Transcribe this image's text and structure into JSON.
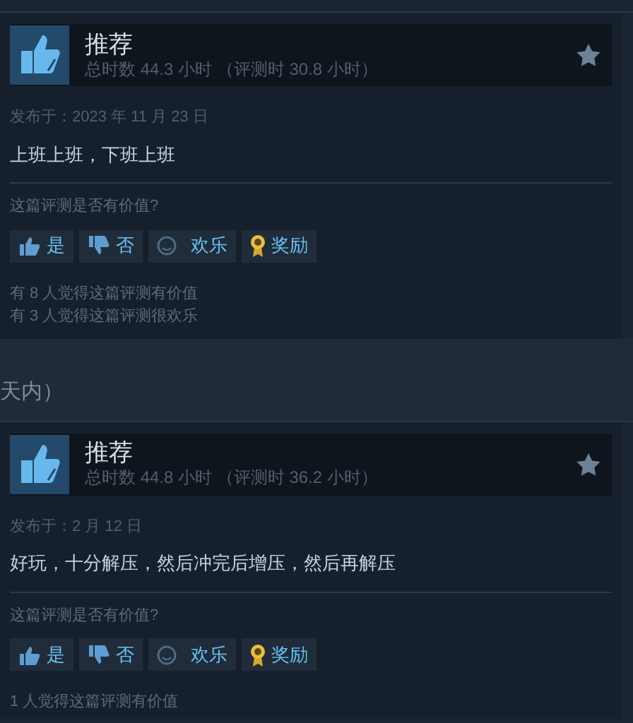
{
  "reviews": [
    {
      "verdict": "推荐",
      "hours": "总时数 44.3 小时 （评测时 30.8 小时）",
      "posted": "发布于：2023 年 11 月 23 日",
      "text": "上班上班，下班上班",
      "question": "这篇评测是否有价值?",
      "buttons": [
        {
          "kind": "yes",
          "label": "是"
        },
        {
          "kind": "no",
          "label": "否"
        },
        {
          "kind": "funny",
          "label": "欢乐"
        },
        {
          "kind": "award",
          "label": "奖励"
        }
      ],
      "stats": [
        "有 8 人觉得这篇评测有价值",
        "有 3 人觉得这篇评测很欢乐"
      ]
    },
    {
      "verdict": "推荐",
      "hours": "总时数 44.8 小时 （评测时 36.2 小时）",
      "posted": "发布于：2 月 12 日",
      "text": "好玩，十分解压，然后冲完后增压，然后再解压",
      "question": "这篇评测是否有价值?",
      "buttons": [
        {
          "kind": "yes",
          "label": "是"
        },
        {
          "kind": "no",
          "label": "否"
        },
        {
          "kind": "funny",
          "label": "欢乐"
        },
        {
          "kind": "award",
          "label": "奖励"
        }
      ],
      "stats": [
        "1 人觉得这篇评测有价值"
      ]
    }
  ],
  "section_heading": "天内）"
}
